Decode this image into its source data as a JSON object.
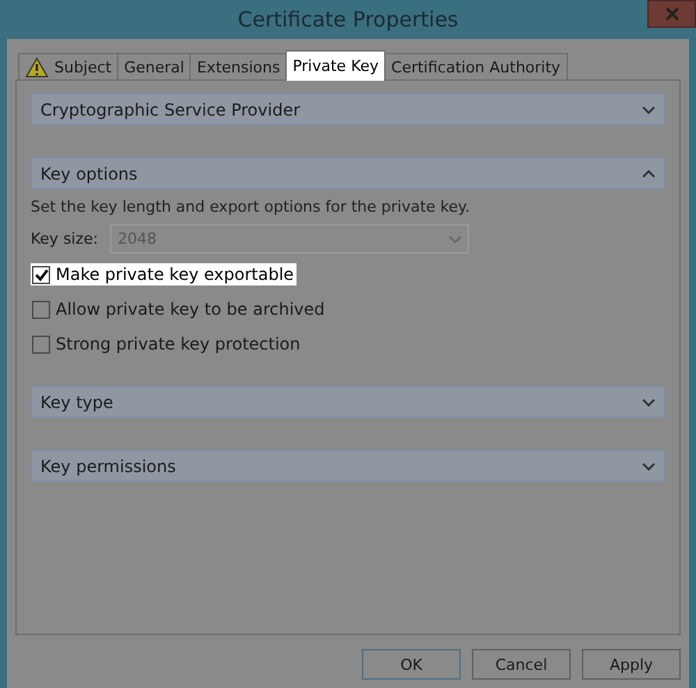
{
  "window": {
    "title": "Certificate Properties"
  },
  "tabs": [
    {
      "label": "Subject",
      "warning": true,
      "selected": false
    },
    {
      "label": "General",
      "warning": false,
      "selected": false
    },
    {
      "label": "Extensions",
      "warning": false,
      "selected": false
    },
    {
      "label": "Private Key",
      "warning": false,
      "selected": true
    },
    {
      "label": "Certification Authority",
      "warning": false,
      "selected": false
    }
  ],
  "sections": [
    {
      "title": "Cryptographic Service Provider",
      "expanded": false
    },
    {
      "title": "Key options",
      "expanded": true,
      "description": "Set the key length and export options for the private key.",
      "key_size": {
        "label": "Key size:",
        "value": "2048",
        "disabled": true
      },
      "options": [
        {
          "label": "Make private key exportable",
          "checked": true,
          "highlighted": true
        },
        {
          "label": "Allow private key to be archived",
          "checked": false,
          "highlighted": false
        },
        {
          "label": "Strong private key protection",
          "checked": false,
          "highlighted": false
        }
      ]
    },
    {
      "title": "Key type",
      "expanded": false
    },
    {
      "title": "Key permissions",
      "expanded": false
    }
  ],
  "buttons": [
    "OK",
    "Cancel",
    "Apply"
  ]
}
